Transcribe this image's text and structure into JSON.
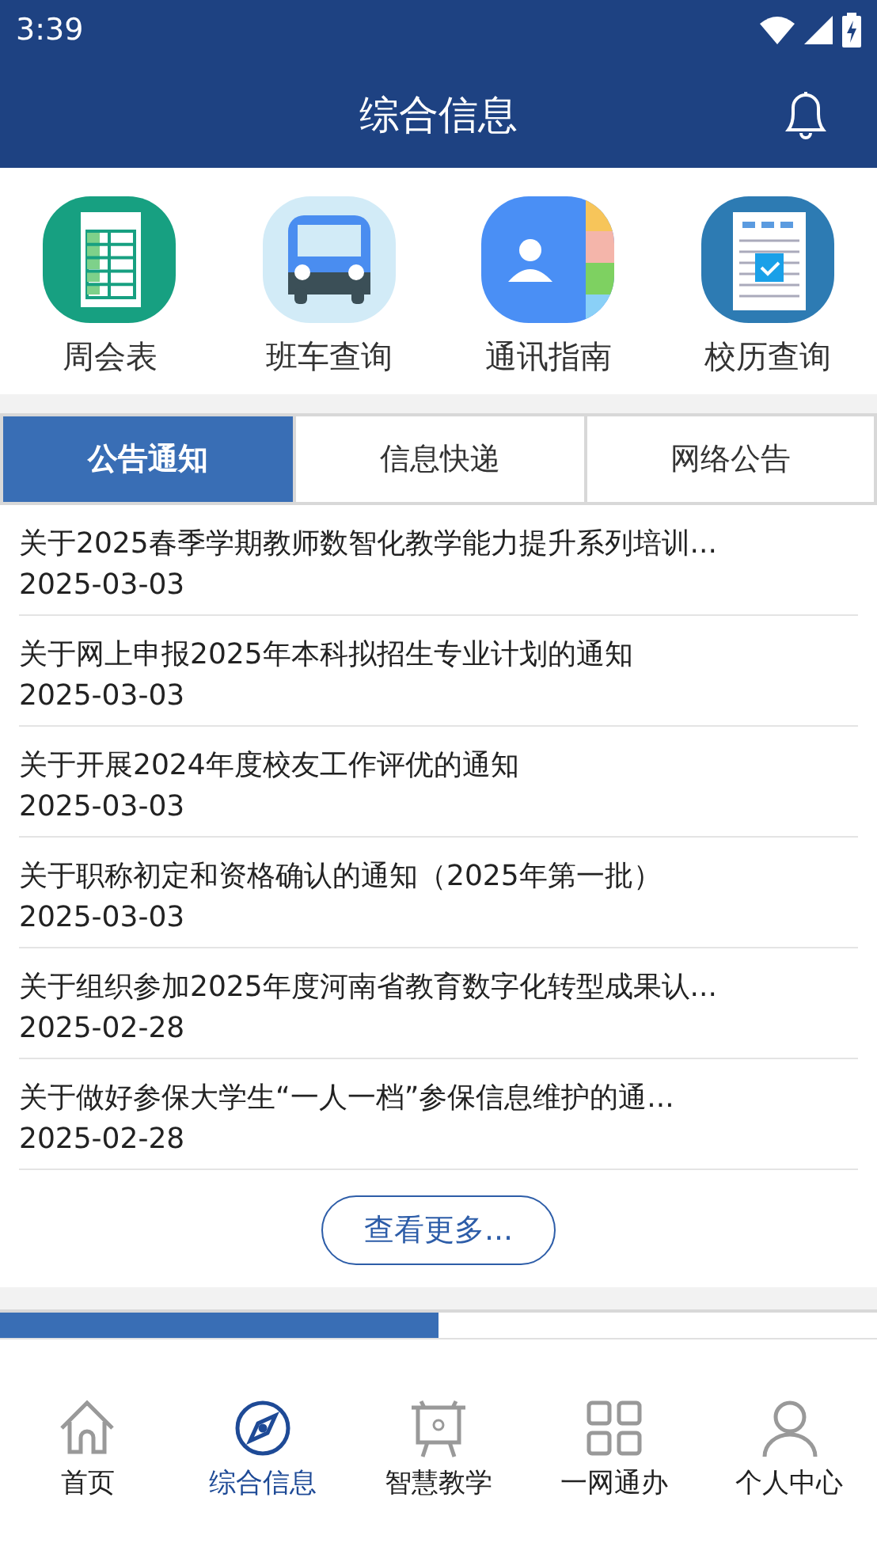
{
  "status_bar": {
    "time": "3:39"
  },
  "header": {
    "title": "综合信息"
  },
  "shortcuts": [
    {
      "kind": "sheet",
      "label": "周会表"
    },
    {
      "kind": "bus",
      "label": "班车查询"
    },
    {
      "kind": "contacts",
      "label": "通讯指南"
    },
    {
      "kind": "calendar",
      "label": "校历查询"
    }
  ],
  "tabs": [
    {
      "label": "公告通知",
      "selected": true
    },
    {
      "label": "信息快递",
      "selected": false
    },
    {
      "label": "网络公告",
      "selected": false
    }
  ],
  "notices": [
    {
      "title": "关于2025春季学期教师数智化教学能力提升系列培训...",
      "date": "2025-03-03"
    },
    {
      "title": "关于网上申报2025年本科拟招生专业计划的通知",
      "date": "2025-03-03"
    },
    {
      "title": "关于开展2024年度校友工作评优的通知",
      "date": "2025-03-03"
    },
    {
      "title": "关于职称初定和资格确认的通知（2025年第一批）",
      "date": "2025-03-03"
    },
    {
      "title": "关于组织参加2025年度河南省教育数字化转型成果认...",
      "date": "2025-02-28"
    },
    {
      "title": "关于做好参保大学生“一人一档”参保信息维护的通...",
      "date": "2025-02-28"
    }
  ],
  "more_button": "查看更多...",
  "second_tabs": [
    {
      "selected": true
    },
    {
      "selected": false
    }
  ],
  "bottom_nav": [
    {
      "kind": "home",
      "label": "首页",
      "selected": false
    },
    {
      "kind": "compass",
      "label": "综合信息",
      "selected": true
    },
    {
      "kind": "easel",
      "label": "智慧教学",
      "selected": false
    },
    {
      "kind": "grid",
      "label": "一网通办",
      "selected": false
    },
    {
      "kind": "person",
      "label": "个人中心",
      "selected": false
    }
  ]
}
